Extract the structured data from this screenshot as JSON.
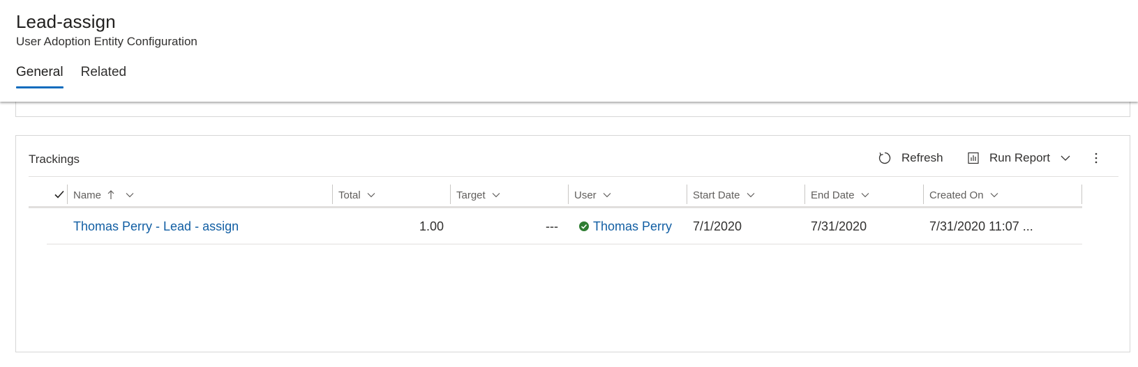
{
  "header": {
    "title": "Lead-assign",
    "subtitle": "User Adoption Entity Configuration",
    "tabs": [
      {
        "label": "General",
        "active": true
      },
      {
        "label": "Related",
        "active": false
      }
    ]
  },
  "trackings": {
    "title": "Trackings",
    "commands": {
      "refresh_label": "Refresh",
      "run_report_label": "Run Report"
    },
    "columns": [
      {
        "label": "Name"
      },
      {
        "label": "Total"
      },
      {
        "label": "Target"
      },
      {
        "label": "User"
      },
      {
        "label": "Start Date"
      },
      {
        "label": "End Date"
      },
      {
        "label": "Created On"
      }
    ],
    "rows": [
      {
        "name": "Thomas Perry - Lead - assign",
        "total": "1.00",
        "target": "---",
        "user": "Thomas Perry",
        "start_date": "7/1/2020",
        "end_date": "7/31/2020",
        "created_on": "7/31/2020 11:07 ..."
      }
    ]
  },
  "colors": {
    "accent": "#0f6cbd",
    "link": "#115ea3",
    "status_ok": "#2e7d32"
  }
}
